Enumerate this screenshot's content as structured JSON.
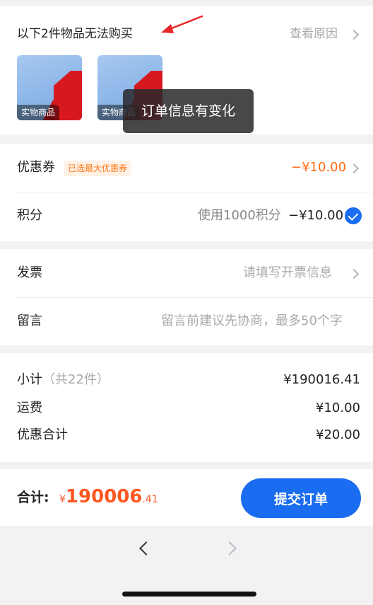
{
  "unavailable": {
    "title": "以下2件物品无法购买",
    "reason_link": "查看原因",
    "items": [
      {
        "tag": "实物商品"
      },
      {
        "tag": "实物商品"
      }
    ],
    "toast": "订单信息有变化"
  },
  "discount": {
    "coupon_label": "优惠券",
    "coupon_badge": "已选最大优惠券",
    "coupon_value": "−¥10.00",
    "points_label": "积分",
    "points_desc": "使用1000积分",
    "points_value": "−¥10.00"
  },
  "invoice": {
    "invoice_label": "发票",
    "invoice_placeholder": "请填写开票信息",
    "message_label": "留言",
    "message_placeholder": "留言前建议先协商，最多50个字"
  },
  "summary": {
    "subtotal_label": "小计",
    "subtotal_count": "（共22件）",
    "subtotal_value": "¥190016.41",
    "shipping_label": "运费",
    "shipping_value": "¥10.00",
    "discount_label": "优惠合计",
    "discount_value": "¥20.00"
  },
  "bottom": {
    "total_label": "合计:",
    "currency": "¥",
    "total_int": "190006",
    "total_dec": ".41",
    "submit_label": "提交订单"
  },
  "nav": {
    "back_icon": "chevron-left-icon",
    "forward_icon": "chevron-right-icon"
  },
  "colors": {
    "accent": "#1a6cf0",
    "price": "#ff5722",
    "badge_text": "#ff7a1a",
    "annotation_arrow": "#e8262b"
  }
}
